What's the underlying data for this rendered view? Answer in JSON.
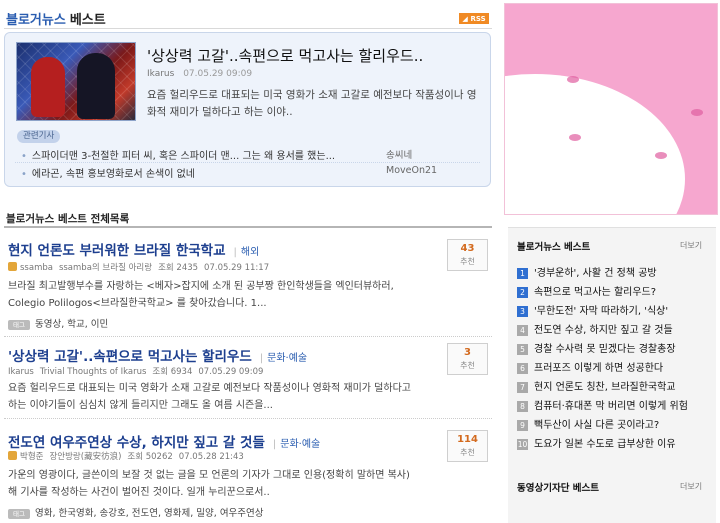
{
  "header": {
    "blog_label": "블로거뉴스",
    "best_label": "베스트",
    "rss_label": "RSS"
  },
  "featured": {
    "title": "'상상력 고갈'..속편으로 먹고사는 할리우드..",
    "author": "Ikarus",
    "date": "07.05.29 09:09",
    "summary": "요즘 헐리우드로 대표되는 미국 영화가 소재 고갈로 예전보다 작품성이나 영화적 재미가 덜하다고 하는 이야..",
    "related_label": "관련기사",
    "related": [
      {
        "title": "스파이더맨 3-천절한 피터 씨, 혹은 스파이더 맨... 그는 왜 용서를 했는...",
        "author": "송씨네"
      },
      {
        "title": "에라곤, 속편 홍보영화로서 손색이 없네",
        "author": "MoveOn21"
      }
    ]
  },
  "list_section": {
    "title": "블로거뉴스 베스트 전체목록"
  },
  "articles": [
    {
      "title": "현지 언론도 부러워한 브라질 한국학교",
      "category": "해외",
      "author": "ssamba",
      "blog": "ssamba의 브라질 아리랑",
      "views_label": "조회",
      "views": "2435",
      "date": "07.05.29 11:17",
      "summary": "브라질 최고발행부수를 자랑하는 <베자>잡지에 소개 된 공부짱 한인학생들을 엑인터뷰하러, Colegio Polilogos<브라질한국학교> 를 찾아갔습니다. 1...",
      "tag_label": "태그",
      "tags": "동영상, 학교, 이민",
      "rec_count": "43",
      "rec_label": "추천"
    },
    {
      "title": "'상상력 고갈'..속편으로 먹고사는 할리우드",
      "category": "문화·예술",
      "author": "Ikarus",
      "blog": "Trivial Thoughts of Ikarus",
      "views_label": "조회",
      "views": "6934",
      "date": "07.05.29 09:09",
      "summary": "요즘 헐리우드로 대표되는 미국 영화가 소재 고갈로 예전보다 작품성이나 영화적 재미가 덜하다고 하는 이야기들이 심심치 않게 들리지만 그래도 올 여름 시즌을...",
      "rec_count": "3",
      "rec_label": "추천"
    },
    {
      "title": "전도연 여우주연상 수상, 하지만 짚고 갈 것들",
      "category": "문화·예술",
      "author": "박형준",
      "blog": "장안방랑(藏安彷浪)",
      "views_label": "조회",
      "views": "50262",
      "date": "07.05.28 21:43",
      "summary": "가운의 영광이다, 글쓴이의 보잘 것 없는 글을 모 언론의 기자가 그대로 인용(정확히 말하면 복사)해 기사를 작성하는 사건이 벌어진 것이다. 일개 누리꾼으로서..",
      "tag_label": "태그",
      "tags": "영화, 한국영화, 송강호, 전도연, 영화제, 밀양, 여우주연상",
      "rec_count": "114",
      "rec_label": "추천"
    }
  ],
  "sidebar": {
    "best_title": "블로거뉴스 베스트",
    "more_label": "더보기",
    "items": [
      {
        "num": "1",
        "title": "'경부운하', 사활 건 정책 공방"
      },
      {
        "num": "2",
        "title": "속편으로 먹고사는 할리우드?"
      },
      {
        "num": "3",
        "title": "'무한도전' 자막 따라하기, '식상'"
      },
      {
        "num": "4",
        "title": "전도연 수상, 하지만 짚고 갈 것들"
      },
      {
        "num": "5",
        "title": "경찰 수사력 못 믿겠다는 경찰총장"
      },
      {
        "num": "6",
        "title": "프러포즈 이렇게 하면 성공한다"
      },
      {
        "num": "7",
        "title": "현지 언론도 칭찬, 브라질한국학교"
      },
      {
        "num": "8",
        "title": "컴퓨터·휴대폰 막 버리면 이렇게 위험"
      },
      {
        "num": "9",
        "title": "뻑두산이 사실 다른 곳이라고?"
      },
      {
        "num": "10",
        "title": "도요가 일본 수도로 급부상한 이유"
      }
    ],
    "footer_title": "동영상기자단 베스트",
    "footer_more": "더보기"
  }
}
